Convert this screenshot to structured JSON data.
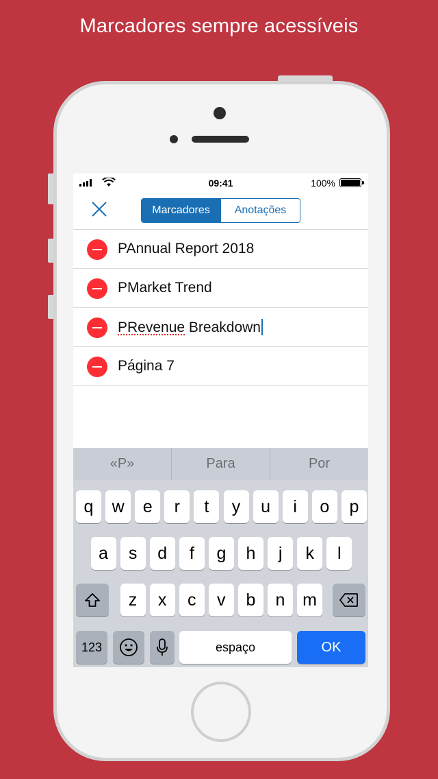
{
  "headline": "Marcadores sempre acessíveis",
  "status_bar": {
    "time": "09:41",
    "battery": "100%"
  },
  "nav": {
    "segments": [
      "Marcadores",
      "Anotações"
    ],
    "active_segment": "Marcadores"
  },
  "bookmarks": [
    {
      "label": "PAnnual Report 2018"
    },
    {
      "label": "PMarket Trend"
    },
    {
      "prefix": "PRevenue",
      "rest": " Breakdown",
      "editing": true
    },
    {
      "label": "Página 7"
    }
  ],
  "keyboard": {
    "suggestions": [
      "«P»",
      "Para",
      "Por"
    ],
    "row1": [
      "q",
      "w",
      "e",
      "r",
      "t",
      "y",
      "u",
      "i",
      "o",
      "p"
    ],
    "row2": [
      "a",
      "s",
      "d",
      "f",
      "g",
      "h",
      "j",
      "k",
      "l"
    ],
    "row3": [
      "z",
      "x",
      "c",
      "v",
      "b",
      "n",
      "m"
    ],
    "numbers_key": "123",
    "space_key": "espaço",
    "ok_key": "OK"
  },
  "colors": {
    "background": "#bf3540",
    "accent": "#1a6fb4",
    "delete": "#fc2e34",
    "ok": "#1a6ef5"
  }
}
